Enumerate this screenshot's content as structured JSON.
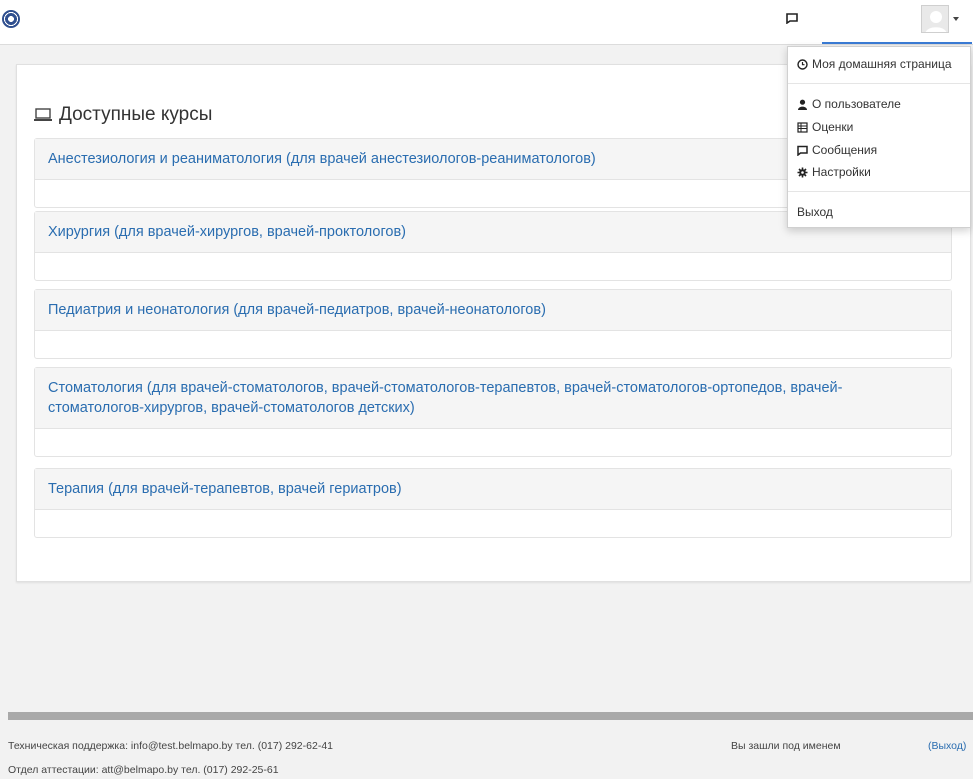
{
  "header": {
    "logo_icon": "globe-logo-icon",
    "messages_icon": "message-icon",
    "avatar_icon": "user-avatar-icon",
    "accent_color": "#3a7bd5"
  },
  "user_menu": {
    "items": [
      {
        "label": "Моя домашняя страница",
        "icon": "clock-icon"
      },
      {
        "label": "О пользователе",
        "icon": "user-icon"
      },
      {
        "label": "Оценки",
        "icon": "table-icon"
      },
      {
        "label": "Сообщения",
        "icon": "message-icon"
      },
      {
        "label": "Настройки",
        "icon": "gear-icon"
      },
      {
        "label": "Выход",
        "icon": ""
      }
    ]
  },
  "main": {
    "title": "Доступные курсы",
    "title_icon": "laptop-icon",
    "courses": [
      {
        "name": "Анестезиология и реаниматология (для врачей анестезиологов-реаниматологов)"
      },
      {
        "name": "Хирургия (для врачей-хирургов, врачей-проктологов)"
      },
      {
        "name": "Педиатрия и неонатология (для врачей-педиатров, врачей-неонатологов)"
      },
      {
        "name": "Стоматология (для врачей-стоматологов, врачей-стоматологов-терапевтов, врачей-стоматологов-ортопедов, врачей-стоматологов-хирургов, врачей-стоматологов детских)"
      },
      {
        "name": "Терапия (для врачей-терапевтов, врачей гериатров)"
      }
    ],
    "link_color": "#2a6db0"
  },
  "footer": {
    "support": "Техническая поддержка: info@test.belmapo.by тел. (017) 292-62-41",
    "attestation": "Отдел аттестации: att@belmapo.by тел. (017) 292-25-61",
    "logged_in_as": "Вы зашли под именем",
    "logout_open": "(",
    "logout_label": "Выход",
    "logout_close": ")"
  }
}
